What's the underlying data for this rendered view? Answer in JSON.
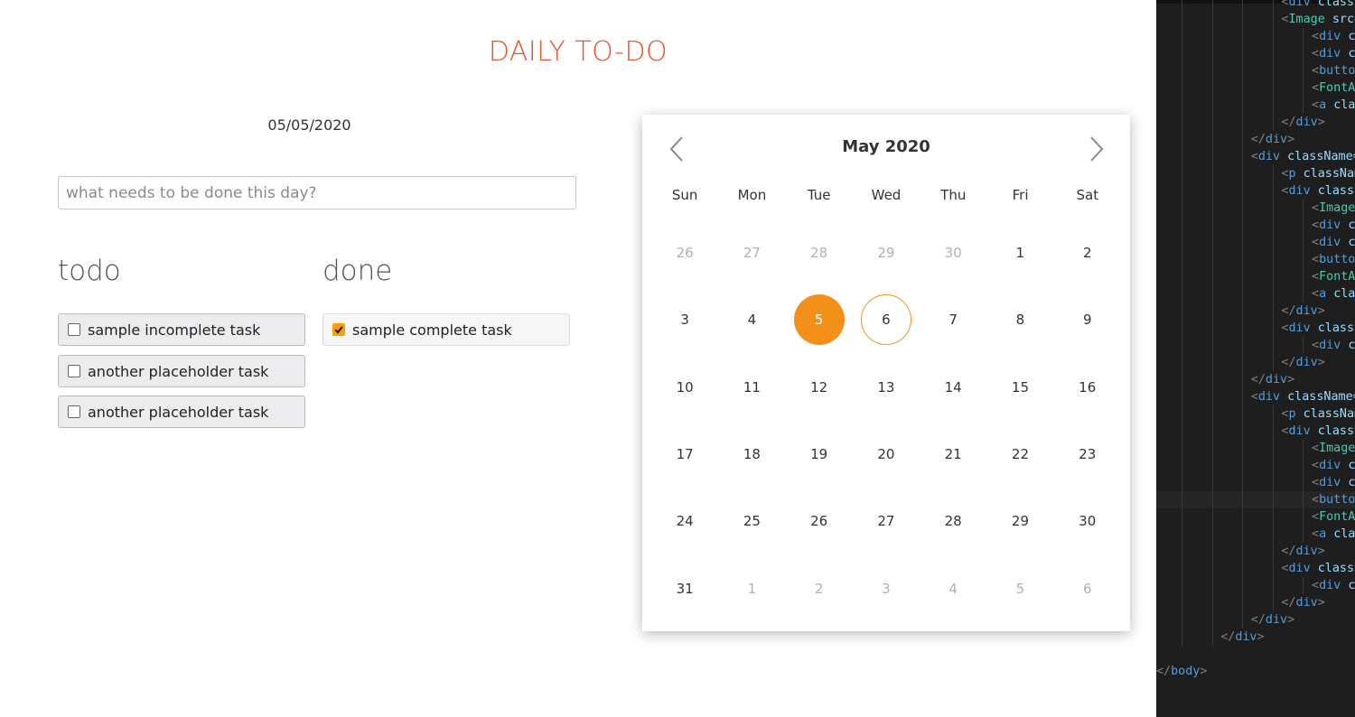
{
  "app": {
    "title": "DAILY TO-DO",
    "date": "05/05/2020",
    "input": {
      "placeholder": "what needs to be done this day?",
      "value": ""
    },
    "todo": {
      "heading": "todo",
      "tasks": [
        {
          "label": "sample incomplete task",
          "checked": false
        },
        {
          "label": "another placeholder task",
          "checked": false
        },
        {
          "label": "another placeholder task",
          "checked": false
        }
      ]
    },
    "done": {
      "heading": "done",
      "tasks": [
        {
          "label": "sample complete task",
          "checked": true
        }
      ]
    }
  },
  "calendar": {
    "month_label": "May 2020",
    "prev_icon": "chevron-left-icon",
    "next_icon": "chevron-right-icon",
    "weekdays": [
      "Sun",
      "Mon",
      "Tue",
      "Wed",
      "Thu",
      "Fri",
      "Sat"
    ],
    "days": [
      {
        "d": "26",
        "muted": true
      },
      {
        "d": "27",
        "muted": true
      },
      {
        "d": "28",
        "muted": true
      },
      {
        "d": "29",
        "muted": true
      },
      {
        "d": "30",
        "muted": true
      },
      {
        "d": "1"
      },
      {
        "d": "2"
      },
      {
        "d": "3"
      },
      {
        "d": "4"
      },
      {
        "d": "5",
        "selected": true
      },
      {
        "d": "6",
        "today": true
      },
      {
        "d": "7"
      },
      {
        "d": "8"
      },
      {
        "d": "9"
      },
      {
        "d": "10"
      },
      {
        "d": "11"
      },
      {
        "d": "12"
      },
      {
        "d": "13"
      },
      {
        "d": "14"
      },
      {
        "d": "15"
      },
      {
        "d": "16"
      },
      {
        "d": "17"
      },
      {
        "d": "18"
      },
      {
        "d": "19"
      },
      {
        "d": "20"
      },
      {
        "d": "21"
      },
      {
        "d": "22"
      },
      {
        "d": "23"
      },
      {
        "d": "24"
      },
      {
        "d": "25"
      },
      {
        "d": "26"
      },
      {
        "d": "27"
      },
      {
        "d": "28"
      },
      {
        "d": "29"
      },
      {
        "d": "30"
      },
      {
        "d": "31"
      },
      {
        "d": "1",
        "muted": true
      },
      {
        "d": "2",
        "muted": true
      },
      {
        "d": "3",
        "muted": true
      },
      {
        "d": "4",
        "muted": true
      },
      {
        "d": "5",
        "muted": true
      },
      {
        "d": "6",
        "muted": true
      }
    ],
    "accent_color": "#f39019"
  },
  "editor": {
    "lines": [
      {
        "indent": 4,
        "text": "<div className"
      },
      {
        "indent": 4,
        "text": "<Image src={Cit"
      },
      {
        "indent": 5,
        "text": "<div classN"
      },
      {
        "indent": 5,
        "text": "<div classN"
      },
      {
        "indent": 5,
        "text": "<button cla"
      },
      {
        "indent": 5,
        "text": "<FontAwesom"
      },
      {
        "indent": 5,
        "text": "<a classNam"
      },
      {
        "indent": 4,
        "text": "</div>"
      },
      {
        "indent": 3,
        "text": "</div>"
      },
      {
        "indent": 3,
        "text": "<div className='j-b"
      },
      {
        "indent": 4,
        "text": "<p className='j"
      },
      {
        "indent": 4,
        "text": "<div className="
      },
      {
        "indent": 5,
        "text": "<Image src="
      },
      {
        "indent": 5,
        "text": "<div classN"
      },
      {
        "indent": 5,
        "text": "<div classN"
      },
      {
        "indent": 5,
        "text": "<button cla"
      },
      {
        "indent": 5,
        "text": "<FontAwesom"
      },
      {
        "indent": 5,
        "text": "<a classNam"
      },
      {
        "indent": 4,
        "text": "</div>"
      },
      {
        "indent": 4,
        "text": "<div className="
      },
      {
        "indent": 5,
        "text": "<div classN"
      },
      {
        "indent": 4,
        "text": "</div>"
      },
      {
        "indent": 3,
        "text": "</div>"
      },
      {
        "indent": 3,
        "text": "<div className='o-b"
      },
      {
        "indent": 4,
        "text": "<p className='j"
      },
      {
        "indent": 4,
        "text": "<div className="
      },
      {
        "indent": 5,
        "text": "<Image src="
      },
      {
        "indent": 5,
        "text": "<div classN"
      },
      {
        "indent": 5,
        "text": "<div classN"
      },
      {
        "indent": 5,
        "text": "<button cla",
        "current": true
      },
      {
        "indent": 5,
        "text": "<FontAwesom"
      },
      {
        "indent": 5,
        "text": "<a classNam"
      },
      {
        "indent": 4,
        "text": "</div>"
      },
      {
        "indent": 4,
        "text": "<div className="
      },
      {
        "indent": 5,
        "text": "<div classN"
      },
      {
        "indent": 4,
        "text": "</div>"
      },
      {
        "indent": 3,
        "text": "</div>"
      },
      {
        "indent": 2,
        "text": "</div>"
      },
      {
        "indent": 0,
        "text": ""
      },
      {
        "indent": 0,
        "text": "</body>"
      }
    ]
  }
}
